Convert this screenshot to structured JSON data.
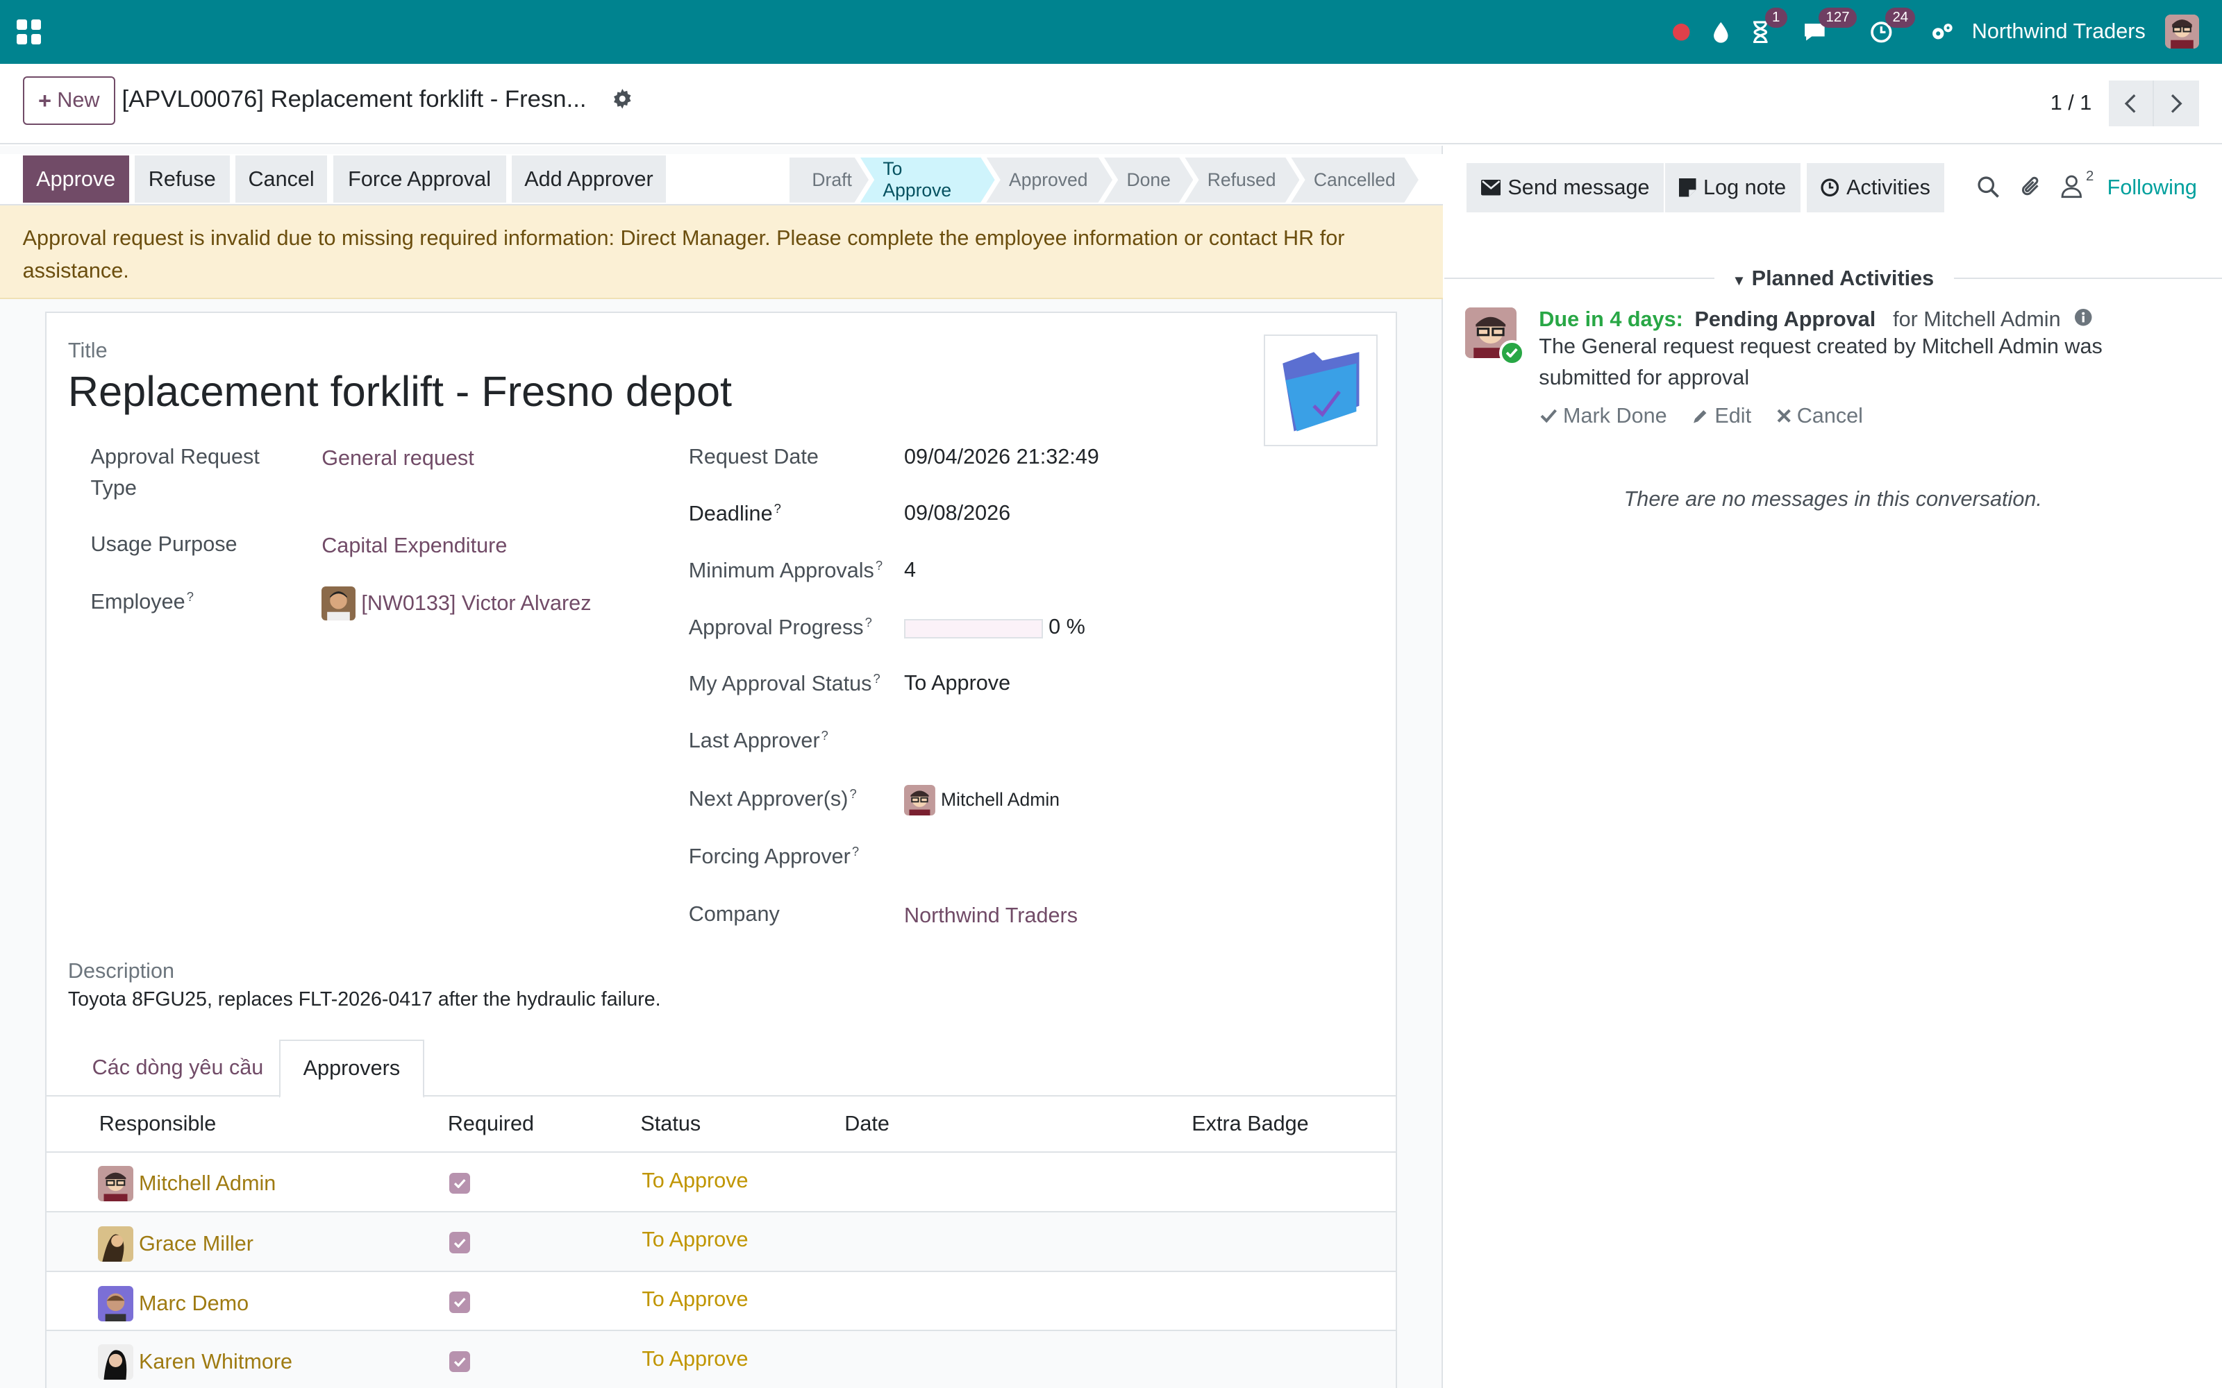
{
  "navbar": {
    "company": "Northwind Traders",
    "badges": {
      "activities": "1",
      "messages": "127",
      "timer": "24"
    }
  },
  "control_panel": {
    "new_label": "New",
    "record_title": "[APVL00076] Replacement forklift - Fresn...",
    "pager": "1 / 1"
  },
  "statusbar": {
    "buttons": {
      "approve": "Approve",
      "refuse": "Refuse",
      "cancel": "Cancel",
      "force": "Force Approval",
      "add_approver": "Add Approver"
    },
    "steps": {
      "draft": "Draft",
      "to_approve": "To Approve",
      "approved": "Approved",
      "done": "Done",
      "refused": "Refused",
      "cancelled": "Cancelled"
    },
    "active_step": "To Approve"
  },
  "alert": "Approval request is invalid due to missing required information: Direct Manager. Please complete the employee information or contact HR for assistance.",
  "form": {
    "title_label": "Title",
    "title": "Replacement forklift - Fresno depot",
    "approval_type_label_1": "Approval Request",
    "approval_type_label_2": "Type",
    "approval_type": "General request",
    "usage_purpose_label": "Usage Purpose",
    "usage_purpose": "Capital Expenditure",
    "employee_label": "Employee",
    "employee": "[NW0133] Victor Alvarez",
    "request_date_label": "Request Date",
    "request_date": "09/04/2026 21:32:49",
    "deadline_label": "Deadline",
    "deadline": "09/08/2026",
    "min_approvals_label": "Minimum Approvals",
    "min_approvals": "4",
    "progress_label": "Approval Progress",
    "progress_value": "0 %",
    "progress_fraction": 0,
    "my_status_label": "My Approval Status",
    "my_status": "To Approve",
    "last_approver_label": "Last Approver",
    "next_approvers_label": "Next Approver(s)",
    "next_approver": "Mitchell Admin",
    "forcing_approver_label": "Forcing Approver",
    "company_label": "Company",
    "company": "Northwind Traders",
    "description_label": "Description",
    "description": "Toyota 8FGU25, replaces FLT-2026-0417 after the hydraulic failure.",
    "help_mark": "?"
  },
  "tabs": {
    "lines": "Các dòng yêu cầu",
    "approvers": "Approvers"
  },
  "approvers_table": {
    "headers": {
      "responsible": "Responsible",
      "required": "Required",
      "status": "Status",
      "date": "Date",
      "extra_badge": "Extra Badge"
    },
    "rows": [
      {
        "name": "Mitchell Admin",
        "required": true,
        "status": "To Approve",
        "date": "",
        "badge": ""
      },
      {
        "name": "Grace Miller",
        "required": true,
        "status": "To Approve",
        "date": "",
        "badge": ""
      },
      {
        "name": "Marc Demo",
        "required": true,
        "status": "To Approve",
        "date": "",
        "badge": ""
      },
      {
        "name": "Karen Whitmore",
        "required": true,
        "status": "To Approve",
        "date": "",
        "badge": ""
      }
    ]
  },
  "chatter": {
    "send_message": "Send message",
    "log_note": "Log note",
    "activities": "Activities",
    "followers_count": "2",
    "following": "Following",
    "planned_activities": "Planned Activities",
    "activity": {
      "due": "Due in 4 days:",
      "type": "Pending Approval",
      "for": "for Mitchell Admin",
      "line1": "The General request request created by Mitchell Admin was",
      "line2": "submitted for approval",
      "mark_done": "Mark Done",
      "edit": "Edit",
      "cancel": "Cancel"
    },
    "no_messages": "There are no messages in this conversation."
  },
  "colors": {
    "navbar": "#00838f",
    "primary": "#714b67",
    "alert_bg": "#fbf0d5",
    "status_text": "#c09500",
    "following": "#00a09d",
    "due": "#28a745"
  }
}
